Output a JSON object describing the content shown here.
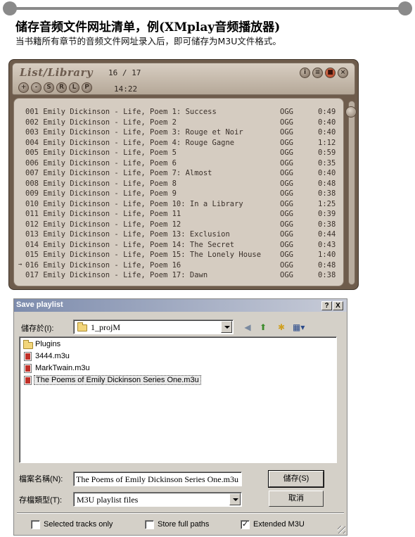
{
  "header": {
    "title": "储存音频文件网址清单，例(XMplay音频播放器)",
    "subtitle": "当书籍所有章节的音频文件网址录入后，即可储存为M3U文件格式。"
  },
  "player": {
    "logo": "List/Library",
    "count": "16 / 17",
    "time": "14:22",
    "control_buttons": [
      "+",
      "-",
      "S",
      "R",
      "L",
      "P"
    ],
    "window_buttons": [
      "i",
      "≡",
      "■",
      "×"
    ],
    "current_marker": "→",
    "tracks": [
      {
        "title": "001 Emily Dickinson - Life, Poem 1: Success",
        "format": "OGG",
        "duration": "0:49"
      },
      {
        "title": "002 Emily Dickinson - Life, Poem 2",
        "format": "OGG",
        "duration": "0:40"
      },
      {
        "title": "003 Emily Dickinson - Life, Poem 3: Rouge et Noir",
        "format": "OGG",
        "duration": "0:40"
      },
      {
        "title": "004 Emily Dickinson - Life, Poem 4: Rouge Gagne",
        "format": "OGG",
        "duration": "1:12"
      },
      {
        "title": "005 Emily Dickinson - Life, Poem 5",
        "format": "OGG",
        "duration": "0:59"
      },
      {
        "title": "006 Emily Dickinson - Life, Poem 6",
        "format": "OGG",
        "duration": "0:35"
      },
      {
        "title": "007 Emily Dickinson - Life, Poem 7: Almost",
        "format": "OGG",
        "duration": "0:40"
      },
      {
        "title": "008 Emily Dickinson - Life, Poem 8",
        "format": "OGG",
        "duration": "0:48"
      },
      {
        "title": "009 Emily Dickinson - Life, Poem 9",
        "format": "OGG",
        "duration": "0:38"
      },
      {
        "title": "010 Emily Dickinson - Life, Poem 10: In a Library",
        "format": "OGG",
        "duration": "1:25"
      },
      {
        "title": "011 Emily Dickinson - Life, Poem 11",
        "format": "OGG",
        "duration": "0:39"
      },
      {
        "title": "012 Emily Dickinson - Life, Poem 12",
        "format": "OGG",
        "duration": "0:38"
      },
      {
        "title": "013 Emily Dickinson - Life, Poem 13: Exclusion",
        "format": "OGG",
        "duration": "0:44"
      },
      {
        "title": "014 Emily Dickinson - Life, Poem 14: The Secret",
        "format": "OGG",
        "duration": "0:43"
      },
      {
        "title": "015 Emily Dickinson - Life, Poem 15: The Lonely House",
        "format": "OGG",
        "duration": "1:40"
      },
      {
        "title": "016 Emily Dickinson - Life, Poem 16",
        "format": "OGG",
        "duration": "0:48"
      },
      {
        "title": "017 Emily Dickinson - Life, Poem 17: Dawn",
        "format": "OGG",
        "duration": "0:38"
      }
    ]
  },
  "dialog": {
    "title": "Save playlist",
    "help_button": "?",
    "close_button": "X",
    "save_in_label": "儲存於(I):",
    "save_in_value": "1_projM",
    "files": [
      {
        "name": "Plugins",
        "type": "folder"
      },
      {
        "name": "3444.m3u",
        "type": "m3u"
      },
      {
        "name": "MarkTwain.m3u",
        "type": "m3u"
      },
      {
        "name": "The Poems of Emily Dickinson Series One.m3u",
        "type": "m3u"
      }
    ],
    "filename_label": "檔案名稱(N):",
    "filename_value": "The Poems of Emily Dickinson Series One.m3u",
    "filetype_label": "存檔類型(T):",
    "filetype_value": "M3U playlist files",
    "save_button": "儲存(S)",
    "cancel_button": "取消",
    "options": [
      {
        "label": "Selected tracks only",
        "checked": false
      },
      {
        "label": "Store full paths",
        "checked": false
      },
      {
        "label": "Extended M3U",
        "checked": true
      }
    ]
  }
}
